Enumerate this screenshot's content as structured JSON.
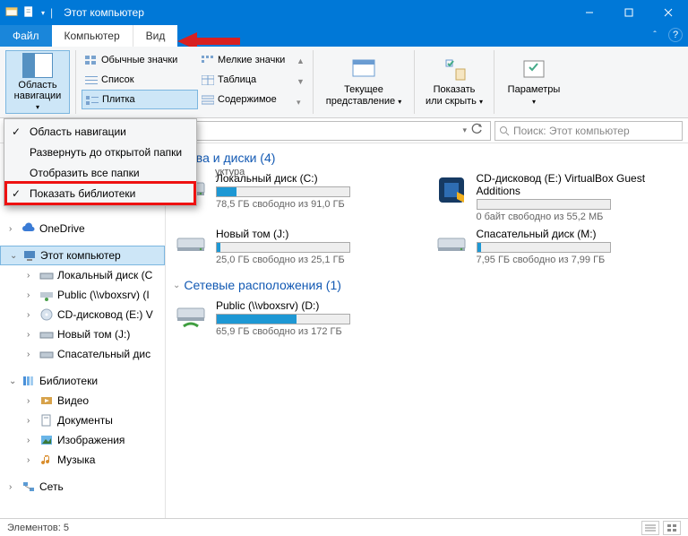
{
  "title": "Этот компьютер",
  "tabs": {
    "file": "Файл",
    "computer": "Компьютер",
    "view": "Вид"
  },
  "help_tip": "?",
  "ribbon": {
    "navpane": "Область\nнавигации",
    "layout": {
      "normal": "Обычные значки",
      "small": "Мелкие значки",
      "list": "Список",
      "table": "Таблица",
      "tiles": "Плитка",
      "content": "Содержимое"
    },
    "structure_cut": "уктура",
    "current_view": "Текущее\nпредставление",
    "show_hide": "Показать\nили скрыть",
    "params": "Параметры"
  },
  "dropdown": {
    "items": [
      {
        "label": "Область навигации",
        "checked": true
      },
      {
        "label": "Развернуть до открытой папки",
        "checked": false
      },
      {
        "label": "Отобразить все папки",
        "checked": false
      },
      {
        "label": "Показать библиотеки",
        "checked": true,
        "highlight": true
      }
    ]
  },
  "address": {
    "path": "",
    "search_placeholder": "Поиск: Этот компьютер"
  },
  "tree": {
    "onedrive": "OneDrive",
    "thispc": "Этот компьютер",
    "drive_c": "Локальный диск (С",
    "public": "Public (\\\\vboxsrv) (I",
    "cddrive": "CD-дисковод (E:) V",
    "newvol": "Новый том (J:)",
    "rescue": "Спасательный дис",
    "libraries": "Библиотеки",
    "video": "Видео",
    "docs": "Документы",
    "images": "Изображения",
    "music": "Музыка",
    "network": "Сеть"
  },
  "content": {
    "devices_hdr": "ства и диски (4)",
    "net_hdr": "Сетевые расположения (1)",
    "drives": [
      {
        "name": "Локальный диск (C:)",
        "sub": "78,5 ГБ свободно из 91,0 ГБ",
        "fill": 15,
        "icon": "hdd"
      },
      {
        "name": "CD-дисковод (E:) VirtualBox Guest Additions",
        "sub": "0 байт свободно из 55,2 МБ",
        "fill": 0,
        "icon": "vbox"
      },
      {
        "name": "Новый том (J:)",
        "sub": "25,0 ГБ свободно из 25,1 ГБ",
        "fill": 3,
        "icon": "hdd"
      },
      {
        "name": "Спасательный диск (M:)",
        "sub": "7,95 ГБ свободно из 7,99 ГБ",
        "fill": 3,
        "icon": "hdd"
      }
    ],
    "network": [
      {
        "name": "Public (\\\\vboxsrv) (D:)",
        "sub": "65,9 ГБ свободно из 172 ГБ",
        "fill": 60,
        "icon": "netdrive"
      }
    ]
  },
  "status": {
    "label": "Элементов: 5"
  }
}
